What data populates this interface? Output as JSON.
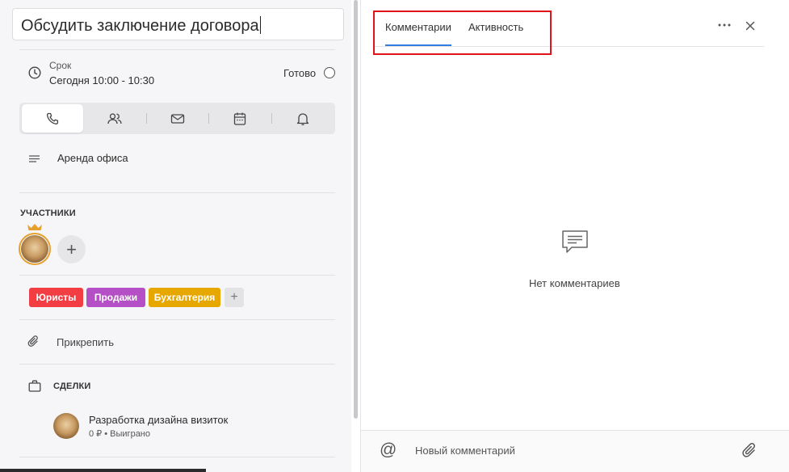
{
  "task": {
    "title": "Обсудить заключение договора",
    "due_label": "Срок",
    "due_value": "Сегодня 10:00 - 10:30",
    "done_label": "Готово",
    "description": "Аренда офиса"
  },
  "type_tabs": [
    {
      "icon": "phone-icon",
      "active": true
    },
    {
      "icon": "people-icon",
      "active": false
    },
    {
      "icon": "mail-icon",
      "active": false
    },
    {
      "icon": "calendar-icon",
      "active": false
    },
    {
      "icon": "bell-icon",
      "active": false
    }
  ],
  "participants": {
    "title": "УЧАСТНИКИ",
    "add_label": "+"
  },
  "tags": [
    {
      "label": "Юристы",
      "color": "#f23d42"
    },
    {
      "label": "Продажи",
      "color": "#b44fc5"
    },
    {
      "label": "Бухгалтерия",
      "color": "#e6a800"
    }
  ],
  "tag_add_label": "+",
  "attach_label": "Прикрепить",
  "deals": {
    "title": "СДЕЛКИ",
    "items": [
      {
        "title": "Разработка дизайна визиток",
        "amount": "0 ₽",
        "separator": "•",
        "status": "Выиграно"
      }
    ]
  },
  "right": {
    "tabs": [
      {
        "label": "Комментарии",
        "active": true
      },
      {
        "label": "Активность",
        "active": false
      }
    ],
    "empty_text": "Нет комментариев",
    "composer_placeholder": "Новый комментарий",
    "at_symbol": "@"
  },
  "colors": {
    "accent": "#2f7ce3",
    "highlight": "#e0121a",
    "crown": "#e6a12d"
  }
}
